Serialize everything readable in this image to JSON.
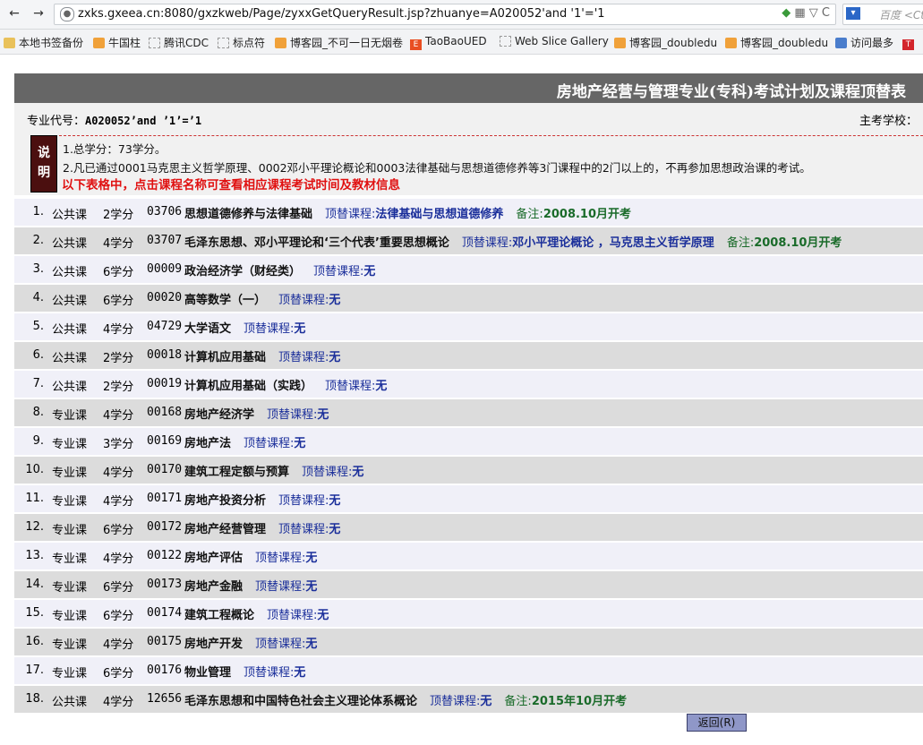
{
  "browser": {
    "url": "zxks.gxeea.cn:8080/gxzkweb/Page/zyxxGetQueryResult.jsp?zhuanye=A020052'and '1'='1",
    "search_placeholder": "百度 <Ctrl",
    "bookmarks": [
      {
        "label": "本地书签备份",
        "icon": "folder-icon"
      },
      {
        "label": "牛国柱",
        "icon": "rss-icon"
      },
      {
        "label": "腾讯CDC",
        "icon": "blank-page-icon"
      },
      {
        "label": "标点符",
        "icon": "blank-page-icon"
      },
      {
        "label": "博客园_不可一日无烟卷",
        "icon": "rss-icon"
      },
      {
        "label": "TaoBaoUED",
        "icon": "e-logo-icon"
      },
      {
        "label": "Web Slice Gallery",
        "icon": "blank-page-icon"
      },
      {
        "label": "博客园_doubledu",
        "icon": "rss-icon"
      },
      {
        "label": "博客园_doubledu",
        "icon": "rss-icon"
      },
      {
        "label": "访问最多",
        "icon": "history-icon"
      }
    ]
  },
  "page": {
    "title": "房地产经营与管理专业(专科)考试计划及课程顶替表",
    "major_code_label": "专业代号：",
    "major_code_value": "A020052’and ’1’=’1",
    "school_label": "主考学校：",
    "note_badge": [
      "说",
      "明"
    ],
    "notes": [
      "1.总学分：73学分。",
      "2.凡已通过0001马克思主义哲学原理、0002邓小平理论概论和0003法律基础与思想道德修养等3门课程中的2门以上的，不再参加思想政治课的考试。"
    ],
    "notice": "以下表格中，点击课程名称可查看相应课程考试时间及教材信息",
    "replace_label": "顶替课程:",
    "remark_label": "备注:",
    "back_button": "返回(R)",
    "courses": [
      {
        "no": "1.",
        "type": "公共课",
        "credit": "2学分",
        "code": "03706",
        "name": "思想道德修养与法律基础",
        "replace": "法律基础与思想道德修养",
        "remark": "2008.10月开考"
      },
      {
        "no": "2.",
        "type": "公共课",
        "credit": "4学分",
        "code": "03707",
        "name": "毛泽东思想、邓小平理论和‘三个代表’重要思想概论",
        "replace": "邓小平理论概论 ，马克思主义哲学原理",
        "remark": "2008.10月开考"
      },
      {
        "no": "3.",
        "type": "公共课",
        "credit": "6学分",
        "code": "00009",
        "name": "政治经济学（财经类）",
        "replace": "无",
        "remark": ""
      },
      {
        "no": "4.",
        "type": "公共课",
        "credit": "6学分",
        "code": "00020",
        "name": "高等数学（一）",
        "replace": "无",
        "remark": ""
      },
      {
        "no": "5.",
        "type": "公共课",
        "credit": "4学分",
        "code": "04729",
        "name": "大学语文",
        "replace": "无",
        "remark": ""
      },
      {
        "no": "6.",
        "type": "公共课",
        "credit": "2学分",
        "code": "00018",
        "name": "计算机应用基础",
        "replace": "无",
        "remark": ""
      },
      {
        "no": "7.",
        "type": "公共课",
        "credit": "2学分",
        "code": "00019",
        "name": "计算机应用基础（实践）",
        "replace": "无",
        "remark": ""
      },
      {
        "no": "8.",
        "type": "专业课",
        "credit": "4学分",
        "code": "00168",
        "name": "房地产经济学",
        "replace": "无",
        "remark": ""
      },
      {
        "no": "9.",
        "type": "专业课",
        "credit": "3学分",
        "code": "00169",
        "name": "房地产法",
        "replace": "无",
        "remark": ""
      },
      {
        "no": "10.",
        "type": "专业课",
        "credit": "4学分",
        "code": "00170",
        "name": "建筑工程定额与预算",
        "replace": "无",
        "remark": ""
      },
      {
        "no": "11.",
        "type": "专业课",
        "credit": "4学分",
        "code": "00171",
        "name": "房地产投资分析",
        "replace": "无",
        "remark": ""
      },
      {
        "no": "12.",
        "type": "专业课",
        "credit": "6学分",
        "code": "00172",
        "name": "房地产经营管理",
        "replace": "无",
        "remark": ""
      },
      {
        "no": "13.",
        "type": "专业课",
        "credit": "4学分",
        "code": "00122",
        "name": "房地产评估",
        "replace": "无",
        "remark": ""
      },
      {
        "no": "14.",
        "type": "专业课",
        "credit": "6学分",
        "code": "00173",
        "name": "房地产金融",
        "replace": "无",
        "remark": ""
      },
      {
        "no": "15.",
        "type": "专业课",
        "credit": "6学分",
        "code": "00174",
        "name": "建筑工程概论",
        "replace": "无",
        "remark": ""
      },
      {
        "no": "16.",
        "type": "专业课",
        "credit": "4学分",
        "code": "00175",
        "name": "房地产开发",
        "replace": "无",
        "remark": ""
      },
      {
        "no": "17.",
        "type": "专业课",
        "credit": "6学分",
        "code": "00176",
        "name": "物业管理",
        "replace": "无",
        "remark": ""
      },
      {
        "no": "18.",
        "type": "公共课",
        "credit": "4学分",
        "code": "12656",
        "name": "毛泽东思想和中国特色社会主义理论体系概论",
        "replace": "无",
        "remark": "2015年10月开考"
      }
    ]
  }
}
